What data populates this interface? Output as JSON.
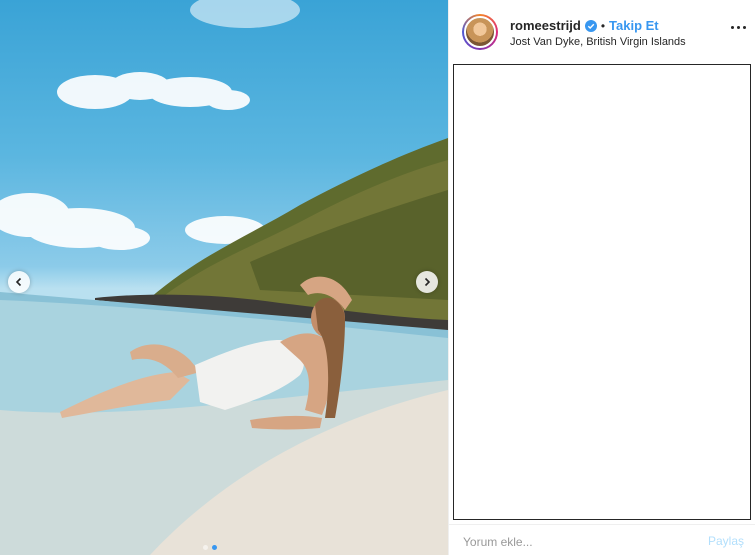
{
  "post": {
    "username": "romeestrijd",
    "separator": "•",
    "follow_label": "Takip Et",
    "location": "Jost Van Dyke, British Virgin Islands"
  },
  "icons": {
    "verified": "verified-badge-icon",
    "more": "more-options-icon",
    "prev": "chevron-left-icon",
    "next": "chevron-right-icon"
  },
  "carousel": {
    "slide_count": 2,
    "active_index": 1
  },
  "comment": {
    "placeholder": "Yorum ekle...",
    "share_label": "Paylaş"
  },
  "colors": {
    "accent": "#3897f0",
    "share_disabled": "#b2dffc",
    "border": "#262626"
  }
}
